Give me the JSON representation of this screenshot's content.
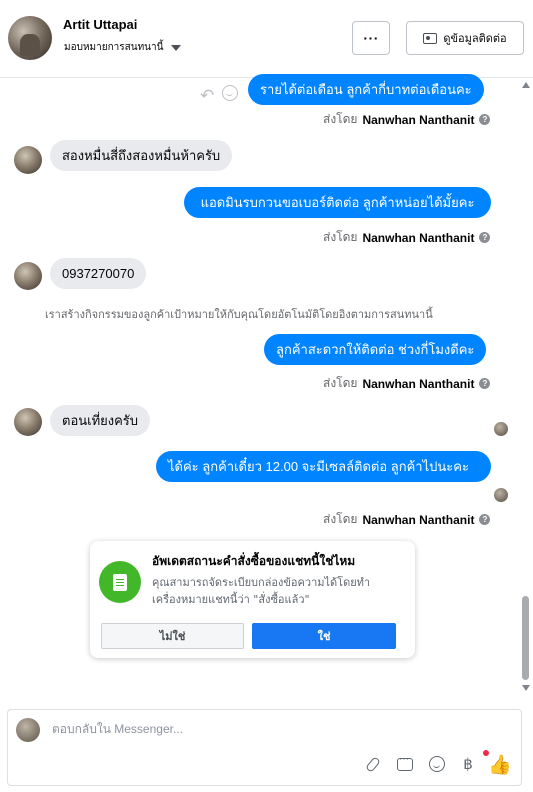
{
  "header": {
    "name": "Artit Uttapai",
    "assign_label": "มอบหมายการสนทนานี้",
    "more_label": "···",
    "contact_label": "ดูข้อมูลติดต่อ"
  },
  "messages": {
    "m1": "รายได้ต่อเดือน ลูกค้ากี่บาทต่อเดือนคะ",
    "m2": "สองหมื่นสี่ถึงสองหมื่นห้าครับ",
    "m3": "แอดมินรบกวนขอเบอร์ติดต่อ ลูกค้าหน่อยได้มั้ยคะ",
    "m4": "0937270070",
    "notice": "เราสร้างกิจกรรมของลูกค้าเป้าหมายให้กับคุณโดยอัตโนมัติโดยอิงตามการสนทนานี้",
    "m5": "ลูกค้าสะดวกให้ติดต่อ ช่วงกี่โมงดีคะ",
    "m6": "ตอนเที่ยงครับ",
    "m7": "ได้ค่ะ ลูกค้าเดี๋ยว 12.00 จะมีเซลล์ติดต่อ ลูกค้าไปนะคะ"
  },
  "sent_by": {
    "prefix": "ส่งโดย",
    "name": "Nanwhan Nanthanit",
    "help": "?"
  },
  "card": {
    "title": "อัพเดตสถานะคำสั่งซื้อของแชทนี้ใช่ไหม",
    "description": "คุณสามารถจัดระเบียบกล่องข้อความได้โดยทำเครื่องหมายแชทนี้ว่า \"สั่งซื้อแล้ว\"",
    "no_label": "ไม่ใช่",
    "yes_label": "ใช่"
  },
  "composer": {
    "placeholder": "ตอบกลับใน Messenger..."
  },
  "icons": {
    "reply": "reply-icon",
    "react": "smile-icon",
    "attach": "paperclip-icon",
    "saved_replies": "chat-bubble-icon",
    "emoji": "emoji-icon",
    "payment": "baht-icon",
    "like": "thumbs-up-icon"
  },
  "colors": {
    "outgoing_bubble": "#0084ff",
    "incoming_bubble": "#e9eaee",
    "primary_button": "#1877f2",
    "card_icon": "#42b72a",
    "notification_dot": "#f02849"
  }
}
